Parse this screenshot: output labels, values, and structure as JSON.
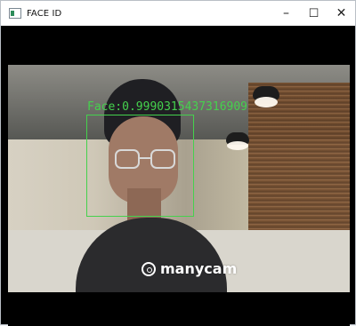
{
  "window": {
    "title": "FACE ID",
    "controls": {
      "minimize": "–",
      "maximize": "☐",
      "close": "✕"
    }
  },
  "overlay": {
    "face_label": "Face:0.9990315437316909",
    "accent_color": "#45d14d"
  },
  "watermark": {
    "text": "manycam"
  }
}
